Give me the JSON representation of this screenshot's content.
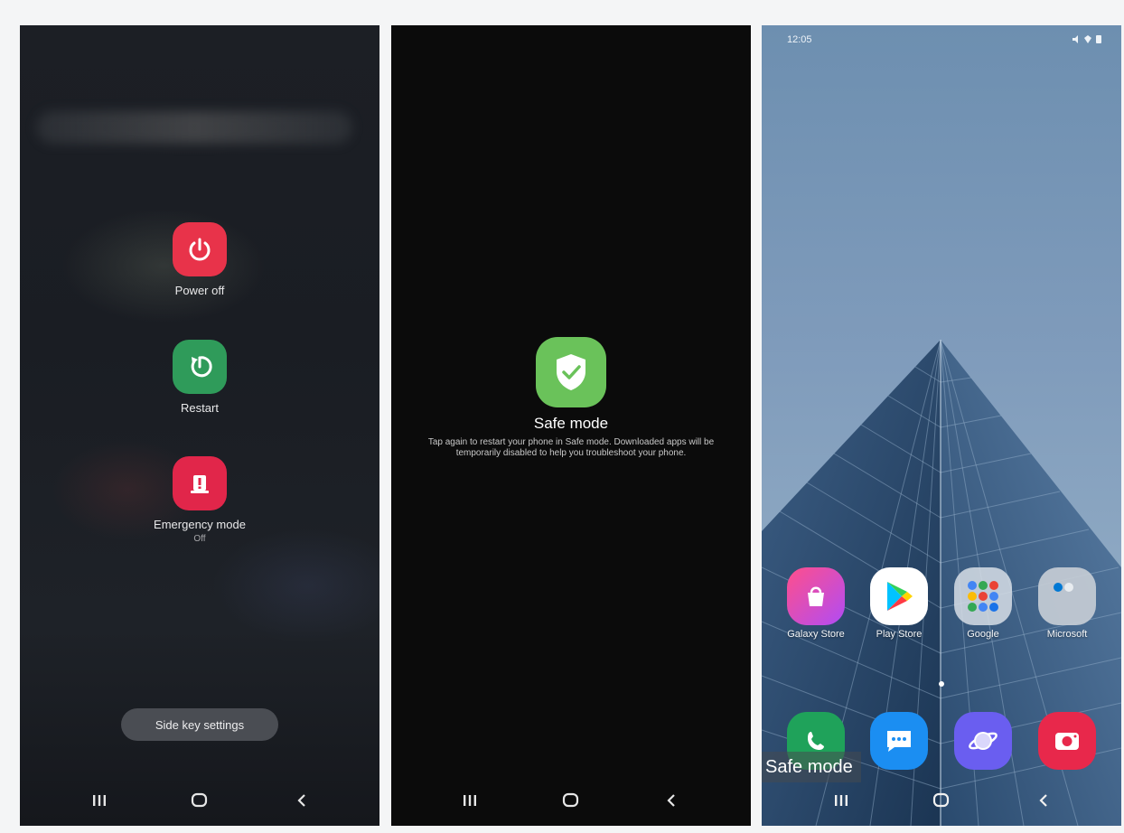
{
  "power_menu": {
    "power_off_label": "Power off",
    "restart_label": "Restart",
    "emergency_label": "Emergency mode",
    "emergency_status": "Off",
    "side_key_label": "Side key settings"
  },
  "safe_mode_prompt": {
    "title": "Safe mode",
    "description": "Tap again to restart your phone in Safe mode. Downloaded apps will be temporarily disabled to help you troubleshoot your phone."
  },
  "home_screen": {
    "status_time": "12:05",
    "apps": [
      "Galaxy Store",
      "Play Store",
      "Google",
      "Microsoft"
    ],
    "safe_mode_badge": "Safe mode"
  },
  "colors": {
    "power_red": "#e8334a",
    "restart_green": "#2f9b5a",
    "emergency_red": "#e1264a",
    "safe_green": "#6ac25a"
  },
  "icons": {
    "power": "power-icon",
    "restart": "restart-icon",
    "emergency": "emergency-icon",
    "safe": "shield-check-icon",
    "nav": [
      "recents-icon",
      "home-icon",
      "back-icon"
    ]
  }
}
